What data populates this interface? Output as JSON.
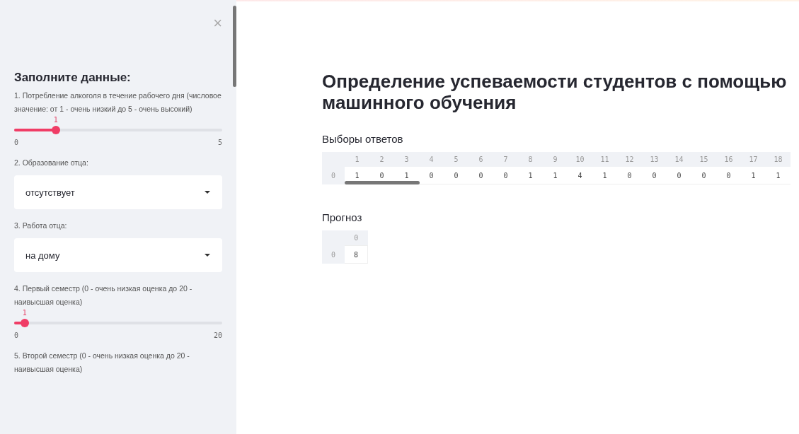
{
  "sidebar": {
    "close_icon": "×",
    "heading": "Заполните данные:",
    "fields": [
      {
        "kind": "slider",
        "label": "1. Потребление алкоголя в течение рабочего дня (числовое значение: от 1 - очень низкий до 5 - очень высокий)",
        "value": "1",
        "level": 0.2,
        "min": "0",
        "max": "5"
      },
      {
        "kind": "select",
        "label": "2. Образование отца:",
        "value": "отсутствует"
      },
      {
        "kind": "select",
        "label": "3. Работа отца:",
        "value": "на дому"
      },
      {
        "kind": "slider",
        "label": "4. Первый семестр (0 - очень низкая оценка до 20 - наивысшая оценка)",
        "value": "1",
        "level": 0.05,
        "min": "0",
        "max": "20"
      },
      {
        "kind": "text",
        "label": "5. Второй семестр (0 - очень низкая оценка до 20 - наивысшая оценка)"
      }
    ]
  },
  "main": {
    "title": "Определение успеваемости студентов с помощью машинного обучения",
    "answers": {
      "heading": "Выборы ответов",
      "columns": [
        "1",
        "2",
        "3",
        "4",
        "5",
        "6",
        "7",
        "8",
        "9",
        "10",
        "11",
        "12",
        "13",
        "14",
        "15",
        "16",
        "17",
        "18"
      ],
      "rows": [
        {
          "index": "0",
          "cells": [
            "1",
            "0",
            "1",
            "0",
            "0",
            "0",
            "0",
            "1",
            "1",
            "4",
            "1",
            "0",
            "0",
            "0",
            "0",
            "0",
            "1",
            "1"
          ]
        }
      ]
    },
    "forecast": {
      "heading": "Прогноз",
      "columns": [
        "0"
      ],
      "rows": [
        {
          "index": "0",
          "cells": [
            "8"
          ]
        }
      ]
    }
  }
}
